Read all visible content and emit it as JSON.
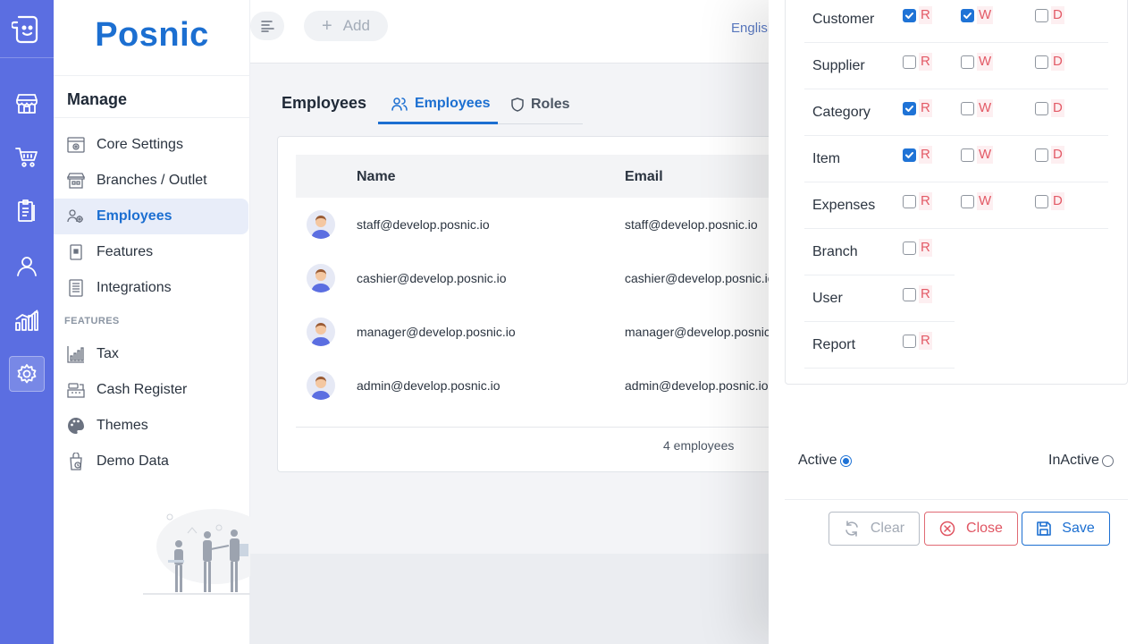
{
  "brand": {
    "name": "Posnic"
  },
  "rail": {
    "items": [
      {
        "icon": "store-icon"
      },
      {
        "icon": "cart-icon"
      },
      {
        "icon": "clipboard-icon"
      },
      {
        "icon": "user-icon"
      },
      {
        "icon": "chart-bars-icon"
      },
      {
        "icon": "gear-icon",
        "active": true
      }
    ]
  },
  "sidebar": {
    "section_title": "Manage",
    "items": [
      {
        "label": "Core Settings",
        "icon": "gear-window-icon"
      },
      {
        "label": "Branches / Outlet",
        "icon": "branch-store-icon"
      },
      {
        "label": "Employees",
        "icon": "employees-icon",
        "active": true
      },
      {
        "label": "Features",
        "icon": "features-icon"
      },
      {
        "label": "Integrations",
        "icon": "integrations-icon"
      }
    ],
    "features_label": "FEATURES",
    "feature_items": [
      {
        "label": "Tax",
        "icon": "tax-icon"
      },
      {
        "label": "Cash Register",
        "icon": "cash-register-icon"
      },
      {
        "label": "Themes",
        "icon": "palette-icon"
      },
      {
        "label": "Demo Data",
        "icon": "demo-data-icon"
      }
    ]
  },
  "topbar": {
    "add_label": "Add",
    "language": "English"
  },
  "main": {
    "page_title": "Employees",
    "tabs": [
      {
        "label": "Employees",
        "active": true
      },
      {
        "label": "Roles",
        "active": false
      }
    ],
    "table": {
      "columns": [
        "Name",
        "Email"
      ],
      "rows": [
        {
          "name": "staff@develop.posnic.io",
          "email": "staff@develop.posnic.io"
        },
        {
          "name": "cashier@develop.posnic.io",
          "email": "cashier@develop.posnic.io"
        },
        {
          "name": "manager@develop.posnic.io",
          "email": "manager@develop.posnic.io"
        },
        {
          "name": "admin@develop.posnic.io",
          "email": "admin@develop.posnic.io"
        }
      ],
      "footer": "4 employees"
    }
  },
  "drawer": {
    "permissions": [
      {
        "label": "Customer",
        "r": true,
        "w": true,
        "d": false,
        "has_wd": true
      },
      {
        "label": "Supplier",
        "r": false,
        "w": false,
        "d": false,
        "has_wd": true
      },
      {
        "label": "Category",
        "r": true,
        "w": false,
        "d": false,
        "has_wd": true
      },
      {
        "label": "Item",
        "r": true,
        "w": false,
        "d": false,
        "has_wd": true
      },
      {
        "label": "Expenses",
        "r": false,
        "w": false,
        "d": false,
        "has_wd": true
      },
      {
        "label": "Branch",
        "r": false,
        "has_wd": false
      },
      {
        "label": "User",
        "r": false,
        "has_wd": false
      },
      {
        "label": "Report",
        "r": false,
        "has_wd": false
      }
    ],
    "perm_letters": {
      "r": "R",
      "w": "W",
      "d": "D"
    },
    "status": {
      "active_label": "Active",
      "inactive_label": "InActive",
      "selected": "active"
    },
    "buttons": {
      "clear": "Clear",
      "close": "Close",
      "save": "Save"
    }
  },
  "colors": {
    "rail_bg": "#5b6ee1",
    "brand_blue": "#1c6fd1",
    "perm_letter": "#e35a66",
    "checkbox_checked": "#1f73d6",
    "close_red": "#e05562"
  }
}
